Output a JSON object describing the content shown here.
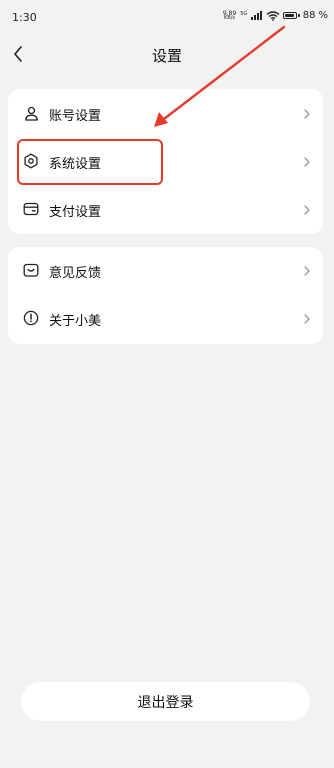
{
  "status_bar": {
    "time": "1:30",
    "net_speed_value": "9.89",
    "net_speed_unit": "KB/s",
    "net_type": "5G",
    "battery": "88"
  },
  "header": {
    "title": "设置"
  },
  "settings_group_1": [
    {
      "label": "账号设置",
      "icon": "user-icon"
    },
    {
      "label": "系统设置",
      "icon": "gear-icon"
    },
    {
      "label": "支付设置",
      "icon": "wallet-icon"
    }
  ],
  "settings_group_2": [
    {
      "label": "意见反馈",
      "icon": "feedback-icon"
    },
    {
      "label": "关于小美",
      "icon": "info-icon"
    }
  ],
  "logout": {
    "label": "退出登录"
  },
  "colors": {
    "background": "#f2f2f2",
    "card": "#ffffff",
    "annotation": "#e53b2c"
  }
}
